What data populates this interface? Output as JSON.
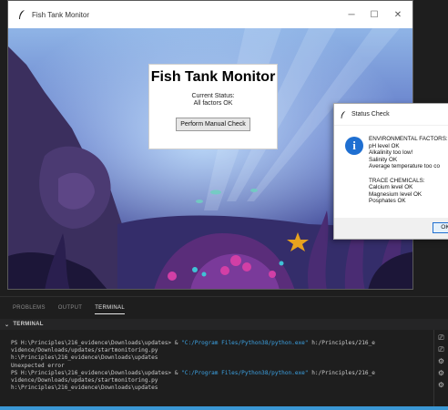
{
  "app_window": {
    "title": "Fish Tank Monitor",
    "controls": {
      "minimize": "─",
      "maximize": "☐",
      "close": "✕"
    },
    "panel": {
      "heading": "Fish Tank Monitor",
      "status_label": "Current Status:",
      "status_value": "All factors OK",
      "button_label": "Perform Manual Check"
    }
  },
  "status_dialog": {
    "title": "Status Check",
    "icon": "info-icon",
    "lines": [
      "ENVIRONMENTAL FACTORS:",
      "pH level OK",
      "Alkalinity too low!",
      "Salinity OK",
      "Average temperature too co",
      "",
      "TRACE CHEMICALS:",
      "Calcium level OK",
      "Magnesium level OK",
      "Posphates OK"
    ],
    "ok_label": "OK"
  },
  "panel_tabs": [
    "PROBLEMS",
    "OUTPUT",
    "TERMINAL"
  ],
  "active_tab": "TERMINAL",
  "terminal": {
    "header": "TERMINAL",
    "lines": [
      [
        {
          "t": "PS H:\\Principles\\216_evidence\\Downloads\\updates> & ",
          "c": "path"
        },
        {
          "t": "\"C:/Program Files/Python38/python.exe\"",
          "c": "str"
        },
        {
          "t": " h:/Principles/216_e",
          "c": "path"
        }
      ],
      [
        {
          "t": "vidence/Downloads/updates/startmonitoring.py",
          "c": "path"
        }
      ],
      [
        {
          "t": "h:\\Principles\\216_evidence\\Downloads\\updates",
          "c": "path"
        }
      ],
      [
        {
          "t": "Unexpected error",
          "c": "path"
        }
      ],
      [
        {
          "t": "PS H:\\Principles\\216_evidence\\Downloads\\updates> & ",
          "c": "path"
        },
        {
          "t": "\"C:/Program Files/Python38/python.exe\"",
          "c": "str"
        },
        {
          "t": " h:/Principles/216_e",
          "c": "path"
        }
      ],
      [
        {
          "t": "vidence/Downloads/updates/startmonitoring.py",
          "c": "path"
        }
      ],
      [
        {
          "t": "h:\\Principles\\216_evidence\\Downloads\\updates",
          "c": "path"
        }
      ]
    ],
    "side_icons": [
      "terminal-icon",
      "terminal-icon",
      "gear-icon",
      "gear-icon",
      "gear-icon"
    ]
  },
  "colors": {
    "accent": "#3a97d4",
    "info_blue": "#1f6fd1",
    "string_blue": "#3ca4e6",
    "editor_bg": "#1e1e1e"
  }
}
